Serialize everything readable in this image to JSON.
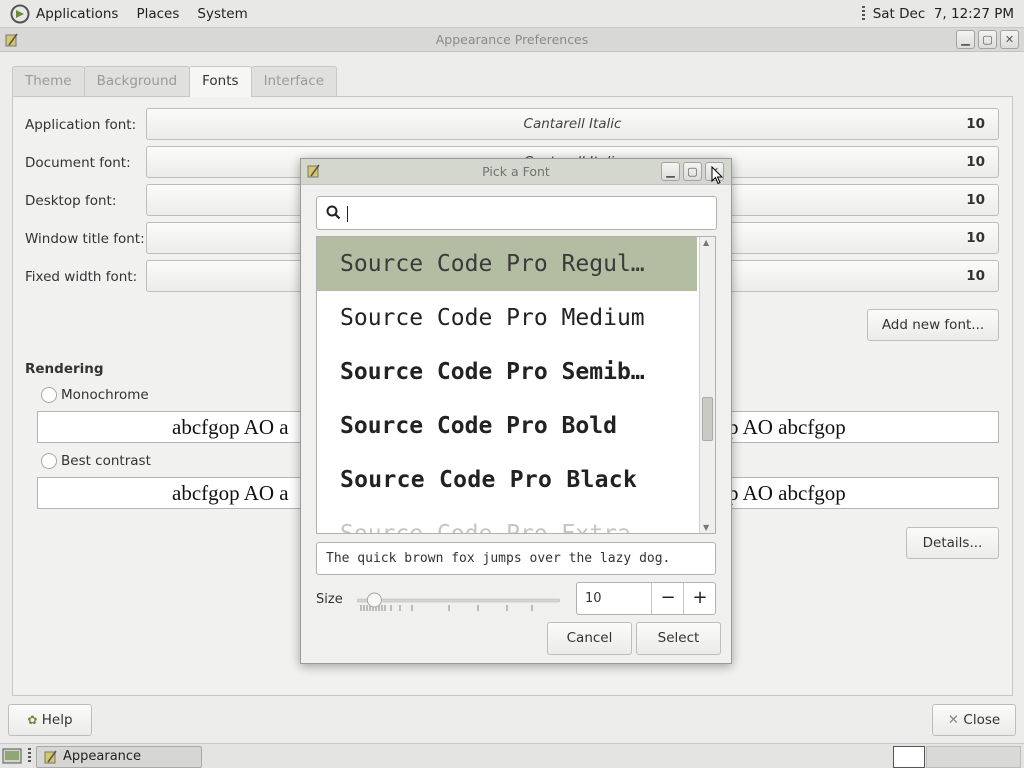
{
  "top_panel": {
    "menus": [
      "Applications",
      "Places",
      "System"
    ],
    "clock": "Sat Dec  7, 12:27 PM"
  },
  "main_window": {
    "title": "Appearance Preferences",
    "tabs": [
      {
        "label": "Theme",
        "active": false
      },
      {
        "label": "Background",
        "active": false
      },
      {
        "label": "Fonts",
        "active": true
      },
      {
        "label": "Interface",
        "active": false
      }
    ],
    "font_rows": [
      {
        "label": "Application font:",
        "font": "Cantarell Italic",
        "size": "10"
      },
      {
        "label": "Document font:",
        "font": "Cantarell Italic",
        "size": "10"
      },
      {
        "label": "Desktop font:",
        "font": "",
        "size": "10"
      },
      {
        "label": "Window title font:",
        "font": "",
        "size": "10"
      },
      {
        "label": "Fixed width font:",
        "font": "",
        "size": "10"
      }
    ],
    "add_font_label": "Add new font...",
    "rendering_heading": "Rendering",
    "rendering_options": [
      {
        "label": "Monochrome",
        "sample_left": "abcfgop AO a",
        "sample_right": "p AO abcfgop"
      },
      {
        "label": "Best contrast",
        "sample_left": "abcfgop AO a",
        "sample_right": "p AO abcfgop"
      }
    ],
    "details_label": "Details...",
    "help_label": "Help",
    "close_label": "Close"
  },
  "dialog": {
    "title": "Pick a Font",
    "search_value": "",
    "fonts": [
      {
        "name": "Source Code Pro Regul…",
        "weight": 400,
        "selected": true
      },
      {
        "name": "Source Code Pro Medium",
        "weight": 500,
        "selected": false
      },
      {
        "name": "Source Code Pro Semib…",
        "weight": 600,
        "selected": false
      },
      {
        "name": "Source Code Pro Bold",
        "weight": 700,
        "selected": false
      },
      {
        "name": "Source Code Pro Black",
        "weight": 900,
        "selected": false
      },
      {
        "name": "Source Code Pro Extra",
        "weight": 200,
        "selected": false
      }
    ],
    "preview_text": "The quick brown fox jumps over the lazy dog.",
    "size_label": "Size",
    "size_value": "10",
    "size_fraction": 0.05,
    "minus_label": "−",
    "plus_label": "+",
    "cancel_label": "Cancel",
    "select_label": "Select"
  },
  "taskbar": {
    "task_label": "Appearance Prefere..."
  },
  "colors": {
    "selection": "#b2bda2",
    "panel": "#e8e8e7"
  }
}
